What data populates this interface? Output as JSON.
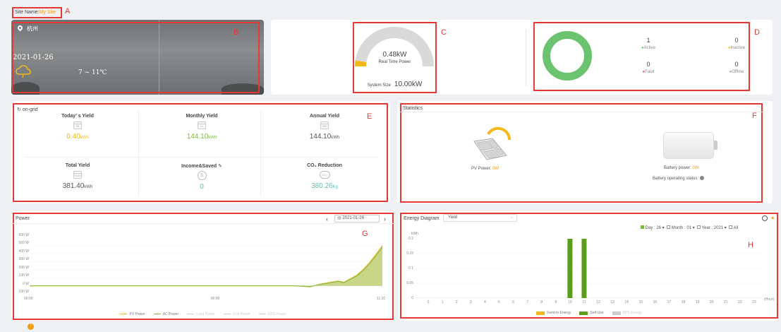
{
  "site": {
    "label": "Site Name:",
    "name": "My Site"
  },
  "tags": {
    "a": "A",
    "b": "B",
    "c": "C",
    "d": "D",
    "e": "E",
    "f": "F",
    "g": "G",
    "h": "H"
  },
  "weather": {
    "city": "杭州",
    "date": "2021-01-26",
    "temp": "7 ~ 11℃"
  },
  "realtime": {
    "value": "0.48kW",
    "label": "Real Time Power",
    "system_size_label": "System Size",
    "system_size_value": "10.00kW",
    "fraction": 0.048
  },
  "inverter_status": {
    "active": {
      "count": "1",
      "label": "Active"
    },
    "inactive": {
      "count": "0",
      "label": "Inactive"
    },
    "fault": {
      "count": "0",
      "label": "Fault"
    },
    "offline": {
      "count": "0",
      "label": "Offline"
    },
    "colors": {
      "active": "#6cc36f",
      "inactive": "#f5c518",
      "fault": "#ef5a7a",
      "offline": "#aaaaaa"
    }
  },
  "yield": {
    "mode": "on-grid",
    "today": {
      "title": "Today’ s Yield",
      "icon_text": "30",
      "value": "0.40",
      "unit": "kWh"
    },
    "monthly": {
      "title": "Monthly Yield",
      "icon_text": "12",
      "value": "144.10",
      "unit": "kWh"
    },
    "annual": {
      "title": "Annual Yield",
      "icon_text": "365",
      "value": "144.10",
      "unit": "kWh"
    },
    "total": {
      "title": "Total Yield",
      "icon_text": "SUM",
      "value": "381.40",
      "unit": "kWh"
    },
    "income": {
      "title": "Income&Saved",
      "value": "0"
    },
    "co2": {
      "title": "CO₂ Reduction",
      "value": "380.26",
      "unit": "Kg"
    }
  },
  "statistics": {
    "title": "Statistics",
    "pv_label": "PV Power: ",
    "pv_value": "0W",
    "battery_label": "Battery power: ",
    "battery_value": "0W",
    "battery_status_label": "Battery operating status:"
  },
  "power_chart": {
    "title": "Power",
    "date": "2021-01-26",
    "y_ticks": [
      "600 W",
      "500 W",
      "400 W",
      "300 W",
      "200 W",
      "100 W",
      "0 W",
      "-100 W"
    ],
    "x_ticks": [
      "00:00",
      "06:00",
      "11:20"
    ],
    "legend": [
      "PV Power",
      "AC Power",
      "Load Power",
      "Grid Power",
      "EPS Power"
    ]
  },
  "energy_chart": {
    "title": "Energy Diagram",
    "select": "Yield",
    "filters": {
      "day": "Day : 26 ▾",
      "month": "Month : 01 ▾",
      "year": "Year : 2021 ▾",
      "all": "All"
    },
    "unit": "kWh",
    "x_unit": "(Hour)",
    "legend": [
      "Feed-in Energy",
      "Self-Use",
      "EPS Energy"
    ]
  },
  "chart_data": [
    {
      "type": "area",
      "title": "Power",
      "x": [
        "00:00",
        "06:00",
        "11:20"
      ],
      "ylim": [
        -100,
        600
      ],
      "series": [
        {
          "name": "PV Power",
          "points": [
            [
              0,
              0
            ],
            [
              8.5,
              0
            ],
            [
              9.0,
              -15
            ],
            [
              9.3,
              20
            ],
            [
              9.6,
              40
            ],
            [
              9.9,
              60
            ],
            [
              10.1,
              45
            ],
            [
              10.3,
              90
            ],
            [
              10.5,
              130
            ],
            [
              10.7,
              200
            ],
            [
              10.9,
              280
            ],
            [
              11.1,
              380
            ],
            [
              11.33,
              500
            ]
          ]
        },
        {
          "name": "AC Power",
          "points": [
            [
              0,
              0
            ],
            [
              8.5,
              0
            ],
            [
              9.0,
              -10
            ],
            [
              9.3,
              15
            ],
            [
              9.6,
              35
            ],
            [
              9.9,
              55
            ],
            [
              10.1,
              40
            ],
            [
              10.3,
              80
            ],
            [
              10.5,
              120
            ],
            [
              10.7,
              185
            ],
            [
              10.9,
              265
            ],
            [
              11.1,
              360
            ],
            [
              11.33,
              480
            ]
          ]
        }
      ]
    },
    {
      "type": "bar",
      "title": "Energy Diagram",
      "categories": [
        "0",
        "1",
        "2",
        "3",
        "4",
        "5",
        "6",
        "7",
        "8",
        "9",
        "10",
        "11",
        "12",
        "13",
        "14",
        "15",
        "16",
        "17",
        "18",
        "19",
        "20",
        "21",
        "22",
        "23"
      ],
      "ylim": [
        0,
        0.2
      ],
      "y_ticks": [
        "0",
        "0.05",
        "0.1",
        "0.15",
        "0.2"
      ],
      "series": [
        {
          "name": "Self-Use",
          "values": [
            0,
            0,
            0,
            0,
            0,
            0,
            0,
            0,
            0,
            0,
            0.2,
            0.2,
            0,
            0,
            0,
            0,
            0,
            0,
            0,
            0,
            0,
            0,
            0,
            0
          ]
        }
      ]
    }
  ]
}
